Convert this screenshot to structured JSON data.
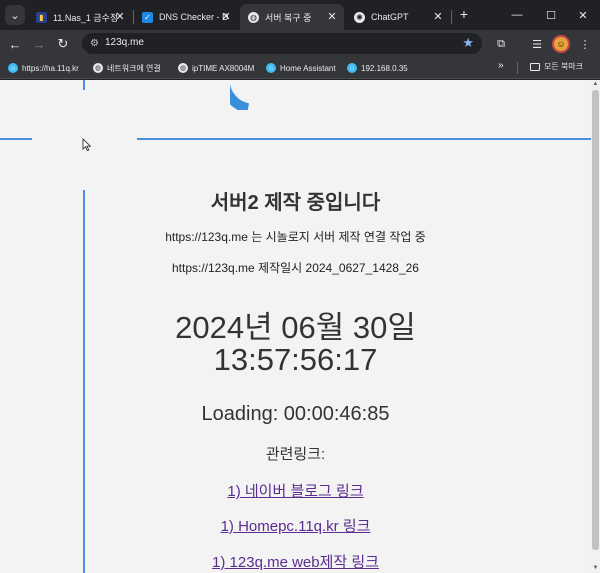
{
  "tabs": [
    {
      "title": "11.Nas_1 금수정",
      "active": false
    },
    {
      "title": "DNS Checker - D",
      "active": false
    },
    {
      "title": "서버 복구 중",
      "active": true
    },
    {
      "title": "ChatGPT",
      "active": false
    }
  ],
  "toolbar": {
    "url": "123q.me"
  },
  "bookmarks": [
    {
      "label": "https://ha.11q.kr",
      "icon": "home-assistant-icon"
    },
    {
      "label": "네트워크에 연결",
      "icon": "globe-icon"
    },
    {
      "label": "ipTIME AX8004M",
      "icon": "globe-icon"
    },
    {
      "label": "Home Assistant",
      "icon": "home-assistant-icon"
    },
    {
      "label": "192.168.0.35",
      "icon": "home-assistant-icon"
    }
  ],
  "bookmarks_folder": "모든 북마크",
  "page": {
    "headline": "서버2 제작 중입니다",
    "line1": "https://123q.me 는 시놀로지 서버 제작 연결 작업 중",
    "line2": "https://123q.me 제작일시 2024_0627_1428_26",
    "date": "2024년 06월 30일",
    "time": "13:57:56:17",
    "loading": "Loading: 00:00:46:85",
    "related": "관련링크:",
    "links": [
      "1) 네이버 블로그 링크",
      "1) Homepc.11q.kr 링크",
      "1) 123q.me web제작 링크"
    ]
  },
  "colors": {
    "accent_blue": "#4a8fdb",
    "link_purple": "#5a2d91",
    "page_bg": "#f3f3f3",
    "chrome_dark": "#202124"
  }
}
